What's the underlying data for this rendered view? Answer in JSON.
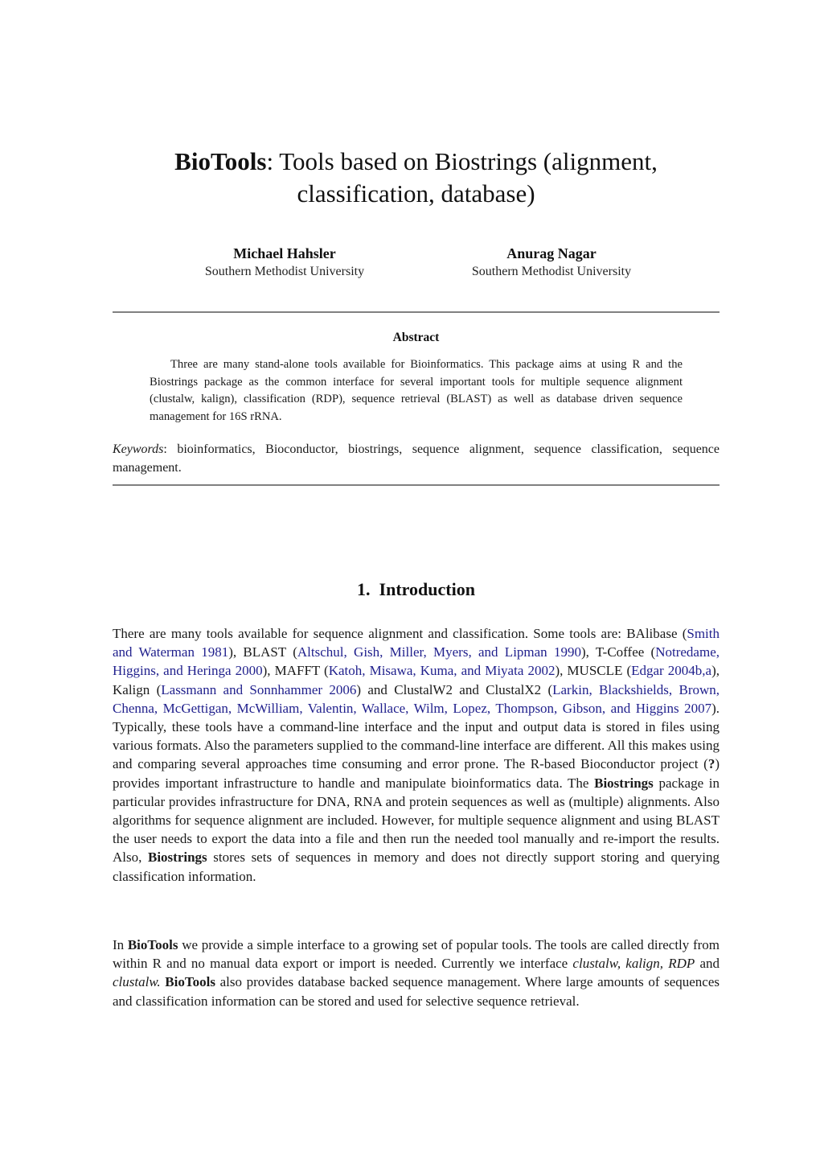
{
  "paper": {
    "title": {
      "bold_part": "BioTools",
      "rest": ": Tools based on Biostrings (alignment, classification, database)"
    },
    "authors": [
      {
        "name": "Michael Hahsler",
        "affiliation": "Southern Methodist University"
      },
      {
        "name": "Anurag Nagar",
        "affiliation": "Southern Methodist University"
      }
    ],
    "abstract": {
      "heading": "Abstract",
      "text": "Three are many stand-alone tools available for Bioinformatics. This package aims at using R and the Biostrings package as the common interface for several important tools for multiple sequence alignment (clustalw, kalign), classification (RDP), sequence retrieval (BLAST) as well as database driven sequence management for 16S rRNA."
    },
    "keywords": {
      "label": "Keywords",
      "text": ": bioinformatics, Bioconductor, biostrings, sequence alignment, sequence classification, sequence management."
    },
    "section": {
      "number": "1.",
      "title": "Introduction"
    },
    "intro_p1": {
      "s1": "There are many tools available for sequence alignment and classification. Some tools are: BAlibase (",
      "c1": "Smith and Waterman 1981",
      "s2": "), BLAST (",
      "c2": "Altschul, Gish, Miller, Myers, and Lipman 1990",
      "s3": "), T-Coffee (",
      "c3": "Notredame, Higgins, and Heringa 2000",
      "s4": "), MAFFT (",
      "c4": "Katoh, Misawa, Kuma, and Miyata 2002",
      "s5": "), MUSCLE (",
      "c5": "Edgar 2004b,a",
      "s6": "), Kalign (",
      "c6": "Lassmann and Sonnhammer 2006",
      "s7": ") and ClustalW2 and ClustalX2 (",
      "c7": "Larkin, Blackshields, Brown, Chenna, McGettigan, McWilliam, Valentin, Wallace, Wilm, Lopez, Thompson, Gibson, and Higgins 2007",
      "s8": "). Typically, these tools have a command-line interface and the input and output data is stored in files using various formats. Also the parameters supplied to the command-line interface are different. All this makes using and comparing several approaches time consuming and error prone. The R-based Bioconductor project (",
      "unresolved": "?",
      "s9": ") provides important infrastructure to handle and manipulate bioinformatics data. The ",
      "b1": "Biostrings",
      "s10": " package in particular provides infrastructure for DNA, RNA and protein sequences as well as (multiple) alignments. Also algorithms for sequence alignment are included. However, for multiple sequence alignment and using BLAST the user needs to export the data into a file and then run the needed tool manually and re-import the results. Also, ",
      "b2": "Biostrings",
      "s11": " stores sets of sequences in memory and does not directly support storing and querying classification information."
    },
    "intro_p2": {
      "s1": "In ",
      "b1": "BioTools",
      "s2": " we provide a simple interface to a growing set of popular tools. The tools are called directly from within R and no manual data export or import is needed. Currently we interface ",
      "i1": "clustalw, kalign, RDP",
      "s3": " and ",
      "i2": "clustalw.",
      "s4": " ",
      "b2": "BioTools",
      "s5": " also provides database backed sequence management. Where large amounts of sequences and classification information can be stored and used for selective sequence retrieval."
    },
    "colors": {
      "citation_link": "#1f1f8c",
      "rule": "#808080",
      "text": "#1a1a1a"
    }
  }
}
